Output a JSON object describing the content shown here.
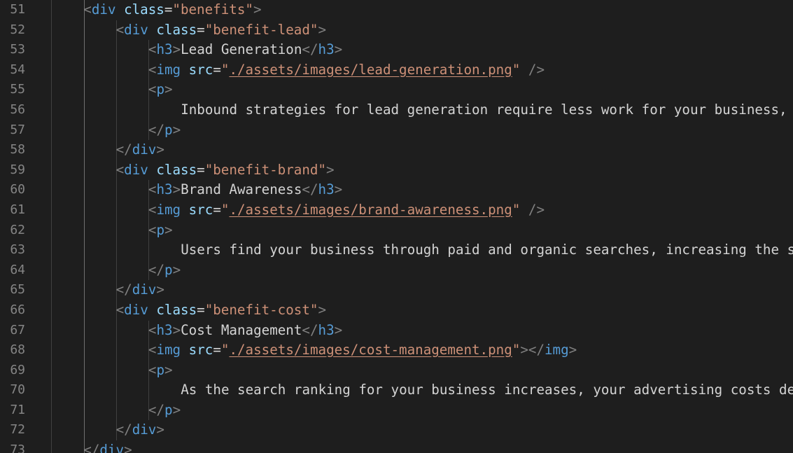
{
  "editor": {
    "lines": [
      {
        "num": "51",
        "indent": 2,
        "tokens": [
          {
            "t": "<",
            "c": "punc"
          },
          {
            "t": "div",
            "c": "tag"
          },
          {
            "t": " ",
            "c": "text"
          },
          {
            "t": "class",
            "c": "attr"
          },
          {
            "t": "=",
            "c": "eq"
          },
          {
            "t": "\"benefits\"",
            "c": "str"
          },
          {
            "t": ">",
            "c": "punc"
          }
        ]
      },
      {
        "num": "52",
        "indent": 3,
        "tokens": [
          {
            "t": "<",
            "c": "punc"
          },
          {
            "t": "div",
            "c": "tag"
          },
          {
            "t": " ",
            "c": "text"
          },
          {
            "t": "class",
            "c": "attr"
          },
          {
            "t": "=",
            "c": "eq"
          },
          {
            "t": "\"benefit-lead\"",
            "c": "str"
          },
          {
            "t": ">",
            "c": "punc"
          }
        ]
      },
      {
        "num": "53",
        "indent": 4,
        "tokens": [
          {
            "t": "<",
            "c": "punc"
          },
          {
            "t": "h3",
            "c": "tag"
          },
          {
            "t": ">",
            "c": "punc"
          },
          {
            "t": "Lead Generation",
            "c": "text"
          },
          {
            "t": "</",
            "c": "punc"
          },
          {
            "t": "h3",
            "c": "tag"
          },
          {
            "t": ">",
            "c": "punc"
          }
        ]
      },
      {
        "num": "54",
        "indent": 4,
        "tokens": [
          {
            "t": "<",
            "c": "punc"
          },
          {
            "t": "img",
            "c": "tag"
          },
          {
            "t": " ",
            "c": "text"
          },
          {
            "t": "src",
            "c": "attr"
          },
          {
            "t": "=",
            "c": "eq"
          },
          {
            "t": "\"",
            "c": "str"
          },
          {
            "t": "./assets/images/lead-generation.png",
            "c": "str link"
          },
          {
            "t": "\"",
            "c": "str"
          },
          {
            "t": " />",
            "c": "punc"
          }
        ]
      },
      {
        "num": "55",
        "indent": 4,
        "tokens": [
          {
            "t": "<",
            "c": "punc"
          },
          {
            "t": "p",
            "c": "tag"
          },
          {
            "t": ">",
            "c": "punc"
          }
        ]
      },
      {
        "num": "56",
        "indent": 5,
        "tokens": [
          {
            "t": "Inbound strategies for lead generation require less work for your business, ",
            "c": "text"
          }
        ]
      },
      {
        "num": "57",
        "indent": 4,
        "tokens": [
          {
            "t": "</",
            "c": "punc"
          },
          {
            "t": "p",
            "c": "tag"
          },
          {
            "t": ">",
            "c": "punc"
          }
        ]
      },
      {
        "num": "58",
        "indent": 3,
        "tokens": [
          {
            "t": "</",
            "c": "punc"
          },
          {
            "t": "div",
            "c": "tag"
          },
          {
            "t": ">",
            "c": "punc"
          }
        ]
      },
      {
        "num": "59",
        "indent": 3,
        "tokens": [
          {
            "t": "<",
            "c": "punc"
          },
          {
            "t": "div",
            "c": "tag"
          },
          {
            "t": " ",
            "c": "text"
          },
          {
            "t": "class",
            "c": "attr"
          },
          {
            "t": "=",
            "c": "eq"
          },
          {
            "t": "\"benefit-brand\"",
            "c": "str"
          },
          {
            "t": ">",
            "c": "punc"
          }
        ]
      },
      {
        "num": "60",
        "indent": 4,
        "tokens": [
          {
            "t": "<",
            "c": "punc"
          },
          {
            "t": "h3",
            "c": "tag"
          },
          {
            "t": ">",
            "c": "punc"
          },
          {
            "t": "Brand Awareness",
            "c": "text"
          },
          {
            "t": "</",
            "c": "punc"
          },
          {
            "t": "h3",
            "c": "tag"
          },
          {
            "t": ">",
            "c": "punc"
          }
        ]
      },
      {
        "num": "61",
        "indent": 4,
        "tokens": [
          {
            "t": "<",
            "c": "punc"
          },
          {
            "t": "img",
            "c": "tag"
          },
          {
            "t": " ",
            "c": "text"
          },
          {
            "t": "src",
            "c": "attr"
          },
          {
            "t": "=",
            "c": "eq"
          },
          {
            "t": "\"",
            "c": "str"
          },
          {
            "t": "./assets/images/brand-awareness.png",
            "c": "str link"
          },
          {
            "t": "\"",
            "c": "str"
          },
          {
            "t": " />",
            "c": "punc"
          }
        ]
      },
      {
        "num": "62",
        "indent": 4,
        "tokens": [
          {
            "t": "<",
            "c": "punc"
          },
          {
            "t": "p",
            "c": "tag"
          },
          {
            "t": ">",
            "c": "punc"
          }
        ]
      },
      {
        "num": "63",
        "indent": 5,
        "tokens": [
          {
            "t": "Users find your business through paid and organic searches, increasing the s",
            "c": "text"
          }
        ]
      },
      {
        "num": "64",
        "indent": 4,
        "tokens": [
          {
            "t": "</",
            "c": "punc"
          },
          {
            "t": "p",
            "c": "tag"
          },
          {
            "t": ">",
            "c": "punc"
          }
        ]
      },
      {
        "num": "65",
        "indent": 3,
        "tokens": [
          {
            "t": "</",
            "c": "punc"
          },
          {
            "t": "div",
            "c": "tag"
          },
          {
            "t": ">",
            "c": "punc"
          }
        ]
      },
      {
        "num": "66",
        "indent": 3,
        "tokens": [
          {
            "t": "<",
            "c": "punc"
          },
          {
            "t": "div",
            "c": "tag"
          },
          {
            "t": " ",
            "c": "text"
          },
          {
            "t": "class",
            "c": "attr"
          },
          {
            "t": "=",
            "c": "eq"
          },
          {
            "t": "\"benefit-cost\"",
            "c": "str"
          },
          {
            "t": ">",
            "c": "punc"
          }
        ]
      },
      {
        "num": "67",
        "indent": 4,
        "tokens": [
          {
            "t": "<",
            "c": "punc"
          },
          {
            "t": "h3",
            "c": "tag"
          },
          {
            "t": ">",
            "c": "punc"
          },
          {
            "t": "Cost Management",
            "c": "text"
          },
          {
            "t": "</",
            "c": "punc"
          },
          {
            "t": "h3",
            "c": "tag"
          },
          {
            "t": ">",
            "c": "punc"
          }
        ]
      },
      {
        "num": "68",
        "indent": 4,
        "tokens": [
          {
            "t": "<",
            "c": "punc"
          },
          {
            "t": "img",
            "c": "tag"
          },
          {
            "t": " ",
            "c": "text"
          },
          {
            "t": "src",
            "c": "attr"
          },
          {
            "t": "=",
            "c": "eq"
          },
          {
            "t": "\"",
            "c": "str"
          },
          {
            "t": "./assets/images/cost-management.png",
            "c": "str link"
          },
          {
            "t": "\"",
            "c": "str"
          },
          {
            "t": "></",
            "c": "punc"
          },
          {
            "t": "img",
            "c": "tag"
          },
          {
            "t": ">",
            "c": "punc"
          }
        ]
      },
      {
        "num": "69",
        "indent": 4,
        "tokens": [
          {
            "t": "<",
            "c": "punc"
          },
          {
            "t": "p",
            "c": "tag"
          },
          {
            "t": ">",
            "c": "punc"
          }
        ]
      },
      {
        "num": "70",
        "indent": 5,
        "tokens": [
          {
            "t": "As the search ranking for your business increases, your advertising costs de",
            "c": "text"
          }
        ]
      },
      {
        "num": "71",
        "indent": 4,
        "tokens": [
          {
            "t": "</",
            "c": "punc"
          },
          {
            "t": "p",
            "c": "tag"
          },
          {
            "t": ">",
            "c": "punc"
          }
        ]
      },
      {
        "num": "72",
        "indent": 3,
        "tokens": [
          {
            "t": "</",
            "c": "punc"
          },
          {
            "t": "div",
            "c": "tag"
          },
          {
            "t": ">",
            "c": "punc"
          }
        ]
      },
      {
        "num": "73",
        "indent": 2,
        "tokens": [
          {
            "t": "</",
            "c": "punc"
          },
          {
            "t": "div",
            "c": "tag"
          },
          {
            "t": ">",
            "c": "punc"
          }
        ]
      }
    ]
  },
  "theme": {
    "background": "#1e1e1e",
    "line_number": "#858585",
    "tag": "#569cd6",
    "attribute": "#9cdcfe",
    "string": "#ce9178",
    "punctuation": "#808080",
    "text": "#d4d4d4"
  }
}
